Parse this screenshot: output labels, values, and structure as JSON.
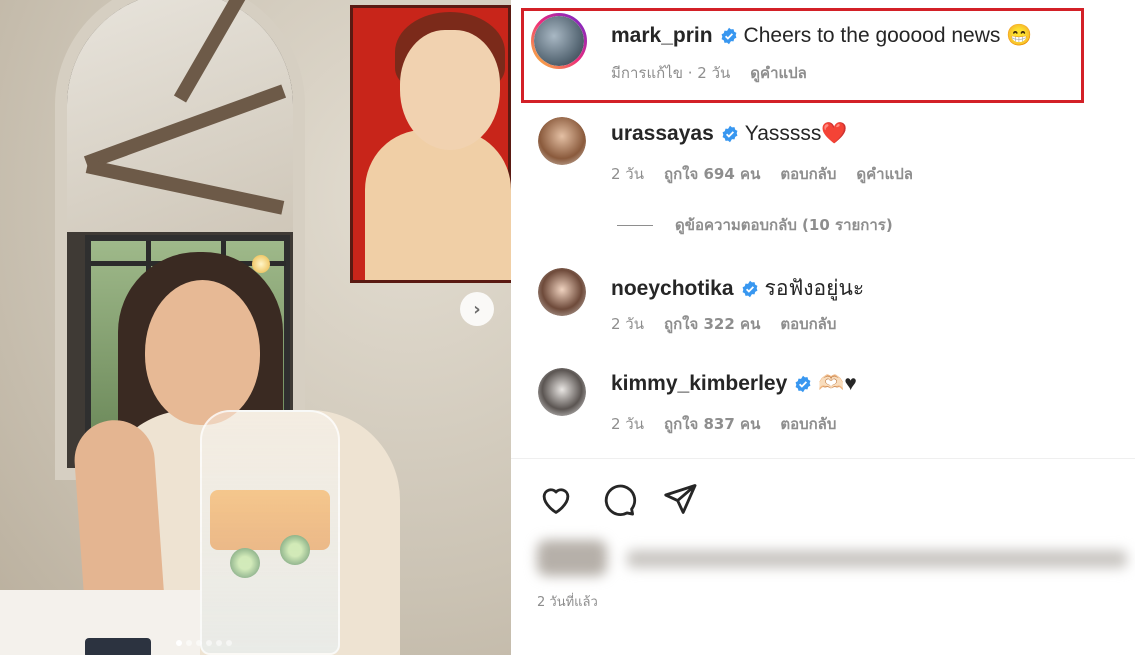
{
  "post": {
    "photo": {
      "carousel_dots_count": 6,
      "active_dot": 0,
      "next_button_icon": "chevron-right-icon"
    }
  },
  "comments": [
    {
      "username": "mark_prin",
      "verified": true,
      "text": "Cheers to the gooood news 😁",
      "meta": [
        "มีการแก้ไข · 2 วัน",
        "ดูคำแปล"
      ],
      "highlighted": true
    },
    {
      "username": "urassayas",
      "verified": true,
      "text": "Yasssss❤️",
      "meta": [
        "2 วัน",
        "ถูกใจ 694 คน",
        "ตอบกลับ",
        "ดูคำแปล"
      ]
    },
    {
      "username": "noeychotika",
      "verified": true,
      "text": "รอฟังอยู่นะ",
      "meta": [
        "2 วัน",
        "ถูกใจ 322 คน",
        "ตอบกลับ"
      ]
    },
    {
      "username": "kimmy_kimberley",
      "verified": true,
      "text": "🫶🏻♥",
      "meta": [
        "2 วัน",
        "ถูกใจ 837 คน",
        "ตอบกลับ"
      ]
    }
  ],
  "view_replies_label": "ดูข้อความตอบกลับ (10 รายการ)",
  "actions": [
    "heart-icon",
    "comment-icon",
    "share-icon"
  ],
  "post_timestamp": "2 วันที่แล้ว",
  "colors": {
    "highlight_border": "#d32027",
    "verified_blue": "#3897f0",
    "meta_gray": "#8e8e8e"
  }
}
